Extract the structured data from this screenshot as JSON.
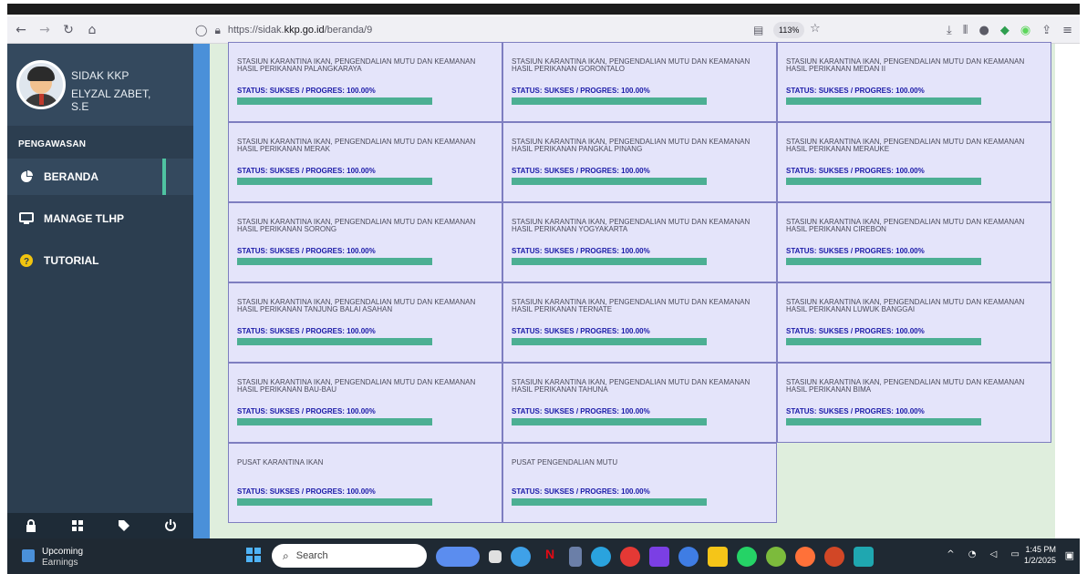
{
  "browser": {
    "url_prefix": "https://sidak.",
    "url_domain": "kkp.go.id",
    "url_path": "/beranda/9",
    "zoom": "113%"
  },
  "sidebar": {
    "app_name": "SIDAK KKP",
    "user_name": "ELYZAL ZABET, S.E",
    "section": "PENGAWASAN",
    "items": [
      {
        "label": "BERANDA",
        "icon": "pie-chart-icon",
        "active": true
      },
      {
        "label": "MANAGE TLHP",
        "icon": "monitor-icon",
        "active": false
      },
      {
        "label": "TUTORIAL",
        "icon": "question-icon",
        "active": false
      }
    ],
    "footer_icons": [
      "lock-icon",
      "grid-icon",
      "tag-icon",
      "power-icon"
    ]
  },
  "cards": [
    {
      "title": "STASIUN KARANTINA IKAN, PENGENDALIAN MUTU DAN KEAMANAN HASIL PERIKANAN PALANGKARAYA",
      "status": "STATUS: SUKSES / PROGRES: 100.00%",
      "progress": 100
    },
    {
      "title": "STASIUN KARANTINA IKAN, PENGENDALIAN MUTU DAN KEAMANAN HASIL PERIKANAN GORONTALO",
      "status": "STATUS: SUKSES / PROGRES: 100.00%",
      "progress": 100
    },
    {
      "title": "STASIUN KARANTINA IKAN, PENGENDALIAN MUTU DAN KEAMANAN HASIL PERIKANAN MEDAN II",
      "status": "STATUS: SUKSES / PROGRES: 100.00%",
      "progress": 100
    },
    {
      "title": "STASIUN KARANTINA IKAN, PENGENDALIAN MUTU DAN KEAMANAN HASIL PERIKANAN MERAK",
      "status": "STATUS: SUKSES / PROGRES: 100.00%",
      "progress": 100
    },
    {
      "title": "STASIUN KARANTINA IKAN, PENGENDALIAN MUTU DAN KEAMANAN HASIL PERIKANAN PANGKAL PINANG",
      "status": "STATUS: SUKSES / PROGRES: 100.00%",
      "progress": 100
    },
    {
      "title": "STASIUN KARANTINA IKAN, PENGENDALIAN MUTU DAN KEAMANAN HASIL PERIKANAN MERAUKE",
      "status": "STATUS: SUKSES / PROGRES: 100.00%",
      "progress": 100
    },
    {
      "title": "STASIUN KARANTINA IKAN, PENGENDALIAN MUTU DAN KEAMANAN HASIL PERIKANAN SORONG",
      "status": "STATUS: SUKSES / PROGRES: 100.00%",
      "progress": 100
    },
    {
      "title": "STASIUN KARANTINA IKAN, PENGENDALIAN MUTU DAN KEAMANAN HASIL PERIKANAN YOGYAKARTA",
      "status": "STATUS: SUKSES / PROGRES: 100.00%",
      "progress": 100
    },
    {
      "title": "STASIUN KARANTINA IKAN, PENGENDALIAN MUTU DAN KEAMANAN HASIL PERIKANAN CIREBON",
      "status": "STATUS: SUKSES / PROGRES: 100.00%",
      "progress": 100
    },
    {
      "title": "STASIUN KARANTINA IKAN, PENGENDALIAN MUTU DAN KEAMANAN HASIL PERIKANAN TANJUNG BALAI ASAHAN",
      "status": "STATUS: SUKSES / PROGRES: 100.00%",
      "progress": 100
    },
    {
      "title": "STASIUN KARANTINA IKAN, PENGENDALIAN MUTU DAN KEAMANAN HASIL PERIKANAN TERNATE",
      "status": "STATUS: SUKSES / PROGRES: 100.00%",
      "progress": 100
    },
    {
      "title": "STASIUN KARANTINA IKAN, PENGENDALIAN MUTU DAN KEAMANAN HASIL PERIKANAN LUWUK BANGGAI",
      "status": "STATUS: SUKSES / PROGRES: 100.00%",
      "progress": 100
    },
    {
      "title": "STASIUN KARANTINA IKAN, PENGENDALIAN MUTU DAN KEAMANAN HASIL PERIKANAN BAU-BAU",
      "status": "STATUS: SUKSES / PROGRES: 100.00%",
      "progress": 100
    },
    {
      "title": "STASIUN KARANTINA IKAN, PENGENDALIAN MUTU DAN KEAMANAN HASIL PERIKANAN TAHUNA",
      "status": "STATUS: SUKSES / PROGRES: 100.00%",
      "progress": 100
    },
    {
      "title": "STASIUN KARANTINA IKAN, PENGENDALIAN MUTU DAN KEAMANAN HASIL PERIKANAN BIMA",
      "status": "STATUS: SUKSES / PROGRES: 100.00%",
      "progress": 100
    },
    {
      "title": "PUSAT KARANTINA IKAN",
      "status": "STATUS: SUKSES / PROGRES: 100.00%",
      "progress": 100
    },
    {
      "title": "PUSAT PENGENDALIAN MUTU",
      "status": "STATUS: SUKSES / PROGRES: 100.00%",
      "progress": 100
    }
  ],
  "taskbar": {
    "weather_line1": "Upcoming",
    "weather_line2": "Earnings",
    "search_label": "Search",
    "time": "1:45 PM",
    "date": "1/2/2025"
  },
  "colors": {
    "sidebar_bg": "#2c3e50",
    "card_bg": "#e4e4fa",
    "status_text": "#1a1aa8",
    "progress_fill": "#4caf93",
    "accent": "#4fc3a1"
  }
}
